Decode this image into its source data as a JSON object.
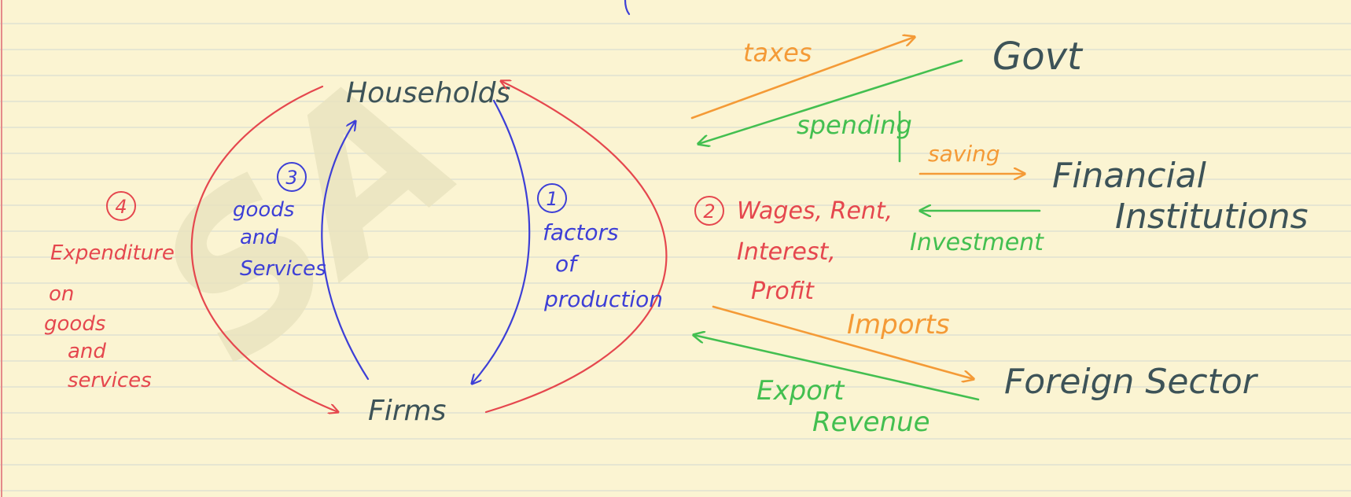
{
  "colors": {
    "paper": "#fbf4d2",
    "rule": "#d9ddd1",
    "margin": "#e58a8a",
    "ink_dark": "#3d5358",
    "ink_red": "#e5474e",
    "ink_blue": "#3d3fd6",
    "ink_orange": "#f49a36",
    "ink_green": "#43bf50",
    "watermark": "#e9e3bf"
  },
  "watermark": {
    "text": "SA"
  },
  "nodes": {
    "households": "Households",
    "firms": "Firms",
    "govt": "Govt",
    "financial_line1": "Financial",
    "financial_line2": "Institutions",
    "foreign": "Foreign Sector"
  },
  "flows": {
    "f1_number": "1",
    "f1_line1": "factors",
    "f1_line2": "of",
    "f1_line3": "production",
    "f2_number": "2",
    "f2_line1": "Wages, Rent,",
    "f2_line2": "Interest,",
    "f2_line3": "Profit",
    "f3_number": "3",
    "f3_line1": "goods",
    "f3_line2": "and",
    "f3_line3": "Services",
    "f4_number": "4",
    "f4_line1": "Expenditure",
    "f4_line2": "on",
    "f4_line3": "goods",
    "f4_line4": "and",
    "f4_line5": "services"
  },
  "sectors": {
    "taxes": "taxes",
    "spending": "spending",
    "saving": "saving",
    "investment": "Investment",
    "imports": "Imports",
    "export_line1": "Export",
    "export_line2": "Revenue"
  }
}
